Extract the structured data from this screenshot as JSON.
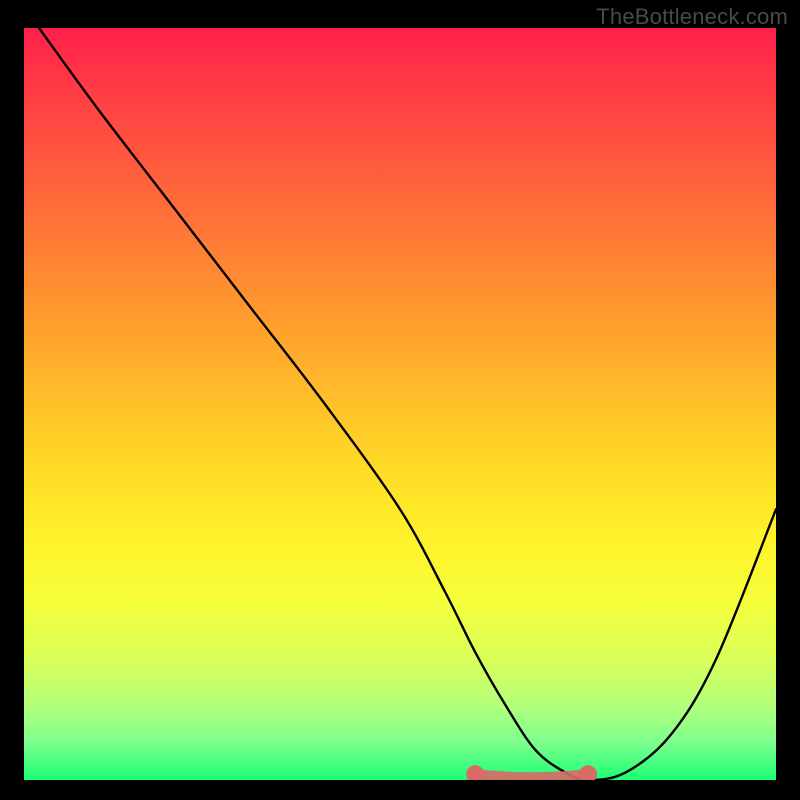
{
  "watermark": "TheBottleneck.com",
  "chart_data": {
    "type": "line",
    "title": "",
    "xlabel": "",
    "ylabel": "",
    "xlim": [
      0,
      100
    ],
    "ylim": [
      0,
      100
    ],
    "grid": false,
    "legend": false,
    "background_gradient": {
      "top_color": "#ff1f4a",
      "mid_color": "#fff22a",
      "bottom_color": "#1aff74"
    },
    "series": [
      {
        "name": "bottleneck-curve",
        "color": "#000000",
        "x": [
          2,
          10,
          20,
          30,
          40,
          50,
          56,
          60,
          64,
          68,
          72,
          75,
          80,
          86,
          92,
          100
        ],
        "y": [
          100,
          89,
          76,
          63,
          50,
          36,
          25,
          17,
          10,
          4,
          1,
          0,
          1,
          6,
          16,
          36
        ]
      }
    ],
    "highlight_segment": {
      "color": "#d86a68",
      "x": [
        60,
        75
      ],
      "y": [
        0.5,
        0.5
      ],
      "endpoints": true
    }
  }
}
